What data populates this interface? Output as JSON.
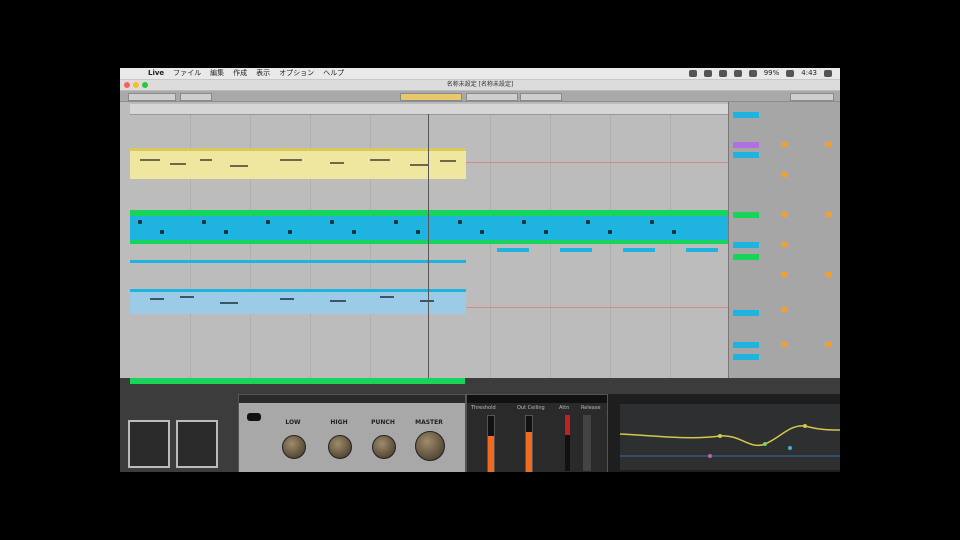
{
  "menubar": {
    "apple": "",
    "app": "Live",
    "items": [
      "ファイル",
      "編集",
      "作成",
      "表示",
      "オプション",
      "ヘルプ"
    ],
    "battery": "99%",
    "time": "4:43"
  },
  "window": {
    "title": "名称未設定 [名称未設定]"
  },
  "colors": {
    "yellow_clip": "#efe6a0",
    "cyan_clip": "#1fb3e0",
    "green_clip": "#19d45a",
    "light_blue": "#9ccbe8",
    "orange": "#f0a030"
  },
  "plugin": {
    "knobs": [
      {
        "label": "LOW"
      },
      {
        "label": "HIGH"
      },
      {
        "label": "PUNCH"
      },
      {
        "label": "MASTER"
      }
    ]
  },
  "compressor": {
    "labels": [
      "Threshold",
      "Out Ceiling",
      "Attn",
      "Release"
    ]
  }
}
